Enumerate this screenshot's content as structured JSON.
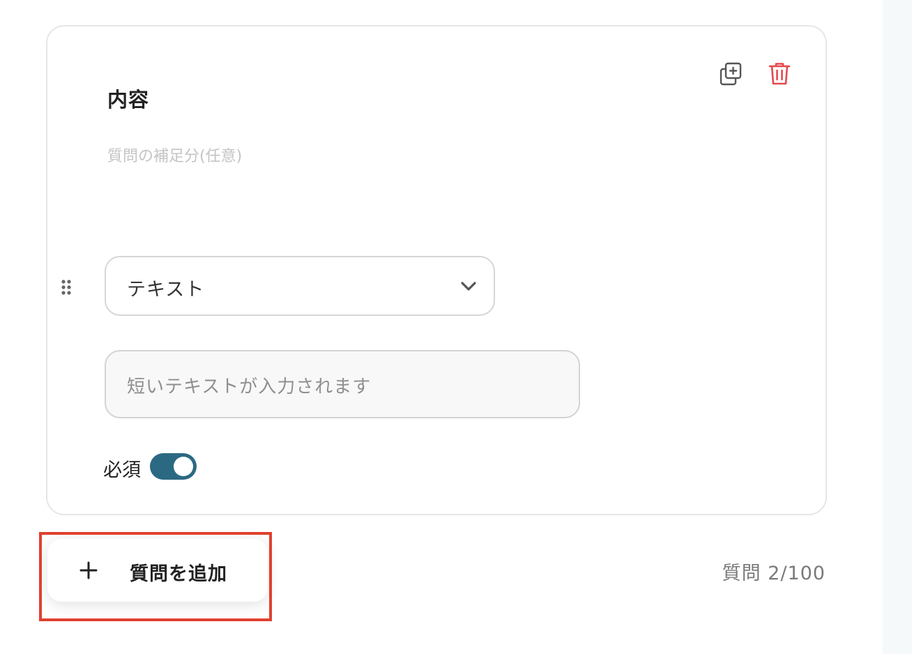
{
  "question": {
    "title": "内容",
    "description_placeholder": "質問の補足分(任意)",
    "type_select": {
      "value": "テキスト"
    },
    "answer_preview": "短いテキストが入力されます",
    "required_label": "必須",
    "required_on": true
  },
  "icons": {
    "copy": "copy-plus-icon",
    "delete": "trash-icon",
    "drag": "drag-handle-icon",
    "chevron": "chevron-down-icon",
    "plus": "plus-icon"
  },
  "footer": {
    "add_question_label": "質問を追加",
    "question_count": "質問 2/100"
  },
  "colors": {
    "toggle_on": "#2b6983",
    "delete_icon": "#e5484d",
    "highlight": "#e0412e"
  }
}
